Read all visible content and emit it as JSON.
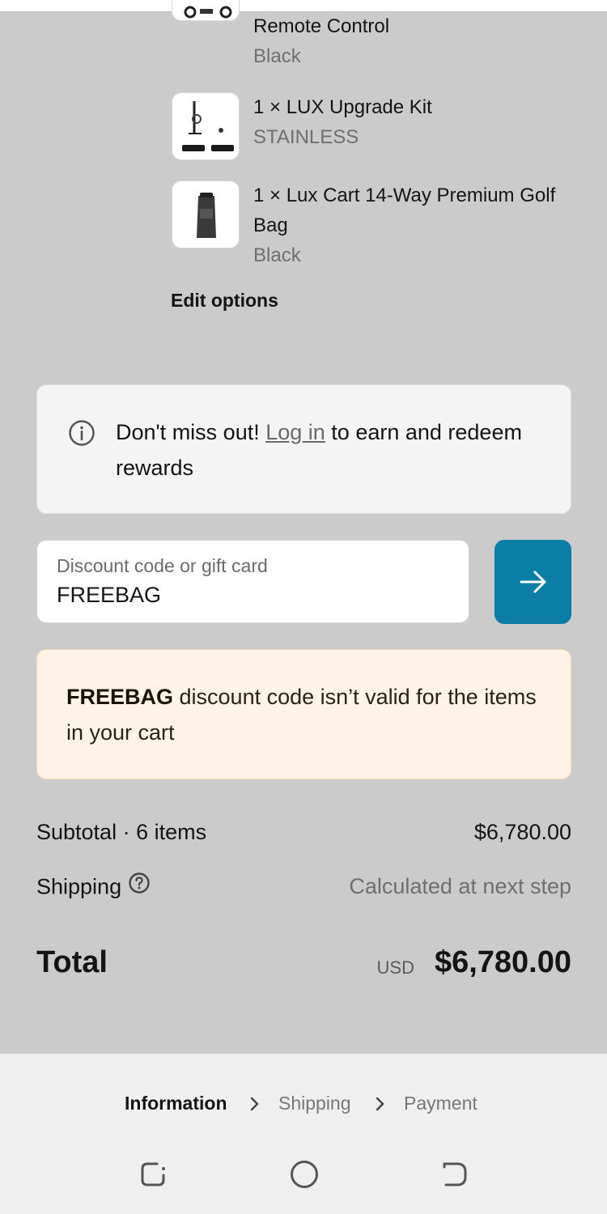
{
  "items": [
    {
      "name": "Remote Control",
      "variant": "Black"
    },
    {
      "name": "1 × LUX Upgrade Kit",
      "variant": "STAINLESS"
    },
    {
      "name": "1 × Lux Cart 14-Way Premium Golf Bag",
      "variant": "Black"
    }
  ],
  "edit_options": "Edit options",
  "rewards": {
    "before": "Don't miss out! ",
    "link": "Log in",
    "after": " to earn and redeem rewards"
  },
  "discount": {
    "label": "Discount code or gift card",
    "value": "FREEBAG"
  },
  "warning": {
    "code": "FREEBAG",
    "message": " discount code isn’t valid for the items in your cart"
  },
  "summary": {
    "subtotal_label": "Subtotal · 6 items",
    "subtotal_value": "$6,780.00",
    "shipping_label": "Shipping",
    "shipping_value": "Calculated at next step",
    "total_label": "Total",
    "currency": "USD",
    "total_value": "$6,780.00"
  },
  "breadcrumb": [
    "Information",
    "Shipping",
    "Payment"
  ],
  "colors": {
    "accent": "#0b7ea8",
    "warning_bg": "#fef3e6"
  },
  "icons": [
    "info-icon",
    "arrow-right-icon",
    "help-icon",
    "chevron-right-icon",
    "recent-apps-icon",
    "home-icon",
    "back-icon"
  ]
}
